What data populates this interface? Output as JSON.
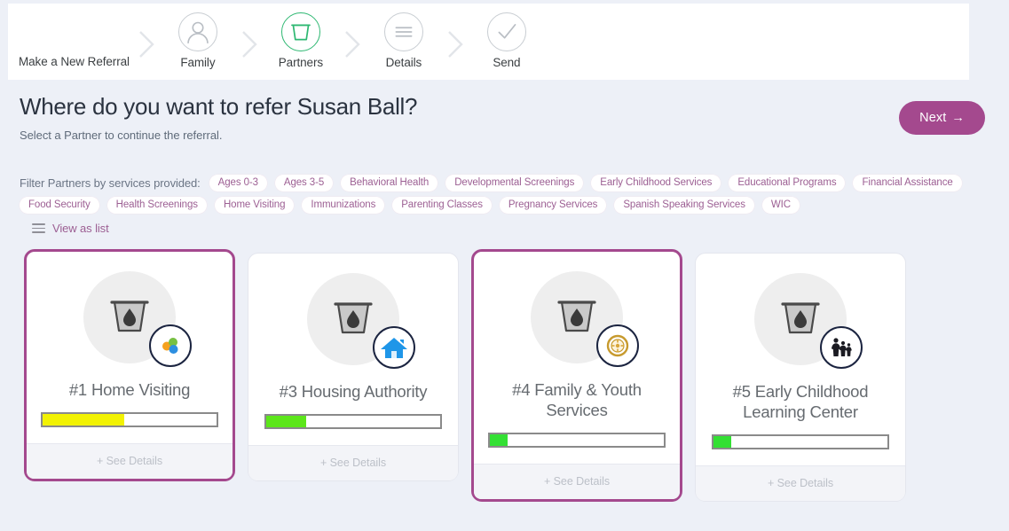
{
  "stepper": {
    "title": "Make a New Referral",
    "steps": [
      {
        "label": "Family",
        "icon": "user-icon",
        "active": false
      },
      {
        "label": "Partners",
        "icon": "bucket-icon",
        "active": true
      },
      {
        "label": "Details",
        "icon": "list-lines-icon",
        "active": false
      },
      {
        "label": "Send",
        "icon": "check-icon",
        "active": false
      }
    ]
  },
  "header": {
    "title": "Where do you want to refer Susan Ball?",
    "subtitle": "Select a Partner to continue the referral.",
    "next_label": "Next",
    "next_arrow": "→",
    "accent_color": "#a4498e"
  },
  "filters": {
    "label": "Filter Partners by services provided:",
    "tags": [
      "Ages 0-3",
      "Ages 3-5",
      "Behavioral Health",
      "Developmental Screenings",
      "Early Childhood Services",
      "Educational Programs",
      "Financial Assistance",
      "Food Security",
      "Health Screenings",
      "Home Visiting",
      "Immunizations",
      "Parenting Classes",
      "Pregnancy Services",
      "Spanish Speaking Services",
      "WIC"
    ]
  },
  "view_toggle": {
    "label": "View as list",
    "icon": "list-icon"
  },
  "cards": [
    {
      "title": "#1 Home Visiting",
      "badge_icon": "three-circles-icon",
      "thumb_icon": "bucket-drop-placeholder-icon",
      "progress_percent": 47,
      "progress_color": "#f2f202",
      "selected": true,
      "see_details_label": "+ See Details"
    },
    {
      "title": "#3 Housing Authority",
      "badge_icon": "blue-house-icon",
      "thumb_icon": "bucket-drop-placeholder-icon",
      "progress_percent": 23,
      "progress_color": "#5ce61a",
      "selected": false,
      "see_details_label": "+ See Details"
    },
    {
      "title": "#4 Family & Youth Services",
      "badge_icon": "gold-emblem-icon",
      "thumb_icon": "bucket-drop-placeholder-icon",
      "progress_percent": 10,
      "progress_color": "#33e033",
      "selected": true,
      "see_details_label": "+ See Details"
    },
    {
      "title": "#5 Early Childhood Learning Center",
      "badge_icon": "family-people-icon",
      "thumb_icon": "bucket-drop-placeholder-icon",
      "progress_percent": 10,
      "progress_color": "#33e033",
      "selected": false,
      "see_details_label": "+ See Details"
    }
  ]
}
